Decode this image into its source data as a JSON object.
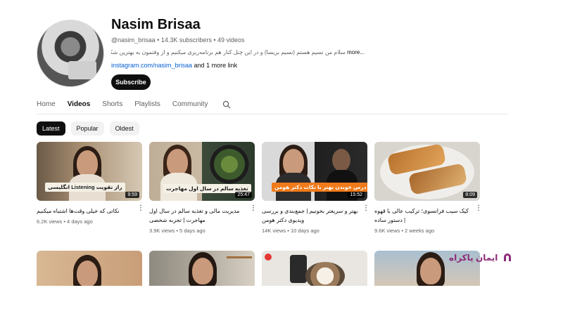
{
  "channel": {
    "name": "Nasim Brisaa",
    "meta": "@nasim_brisaa • 14.3K subscribers • 49 videos",
    "description": "سلام من نسیم هستم (نسیم بریسا) و در این چنل کنار هم برنامه‌ریزی میکنیم و از وقتمون به بهترین شکل استفاده میکنیم. باهم کتاب",
    "more_label": "...more",
    "link_text": "instagram.com/nasim_brisaa",
    "link_suffix": " and 1 more link",
    "subscribe_label": "Subscribe"
  },
  "tabs": [
    "Home",
    "Videos",
    "Shorts",
    "Playlists",
    "Community"
  ],
  "chips": [
    "Latest",
    "Popular",
    "Oldest"
  ],
  "videos": [
    {
      "overlay": "راز تقویت Listening انگلیسی",
      "duration": "9:59",
      "title": "نکاتی که خیلی وقت‌ها اشتباه میکنیم",
      "meta": "6.2K views • 4 days ago"
    },
    {
      "overlay": "تغذیه سالم در سال اول مهاجرت",
      "duration": "25:47",
      "title": "مدیریت مالی و تغذیه سالم در سال اول مهاجرت | تجربه شخصی",
      "meta": "3.9K views • 5 days ago"
    },
    {
      "overlay": "درس خوندن بهتر با نکات دکتر هومن",
      "duration": "15:52",
      "title": "بهتر و سریعتر بخونیم | جمع‌بندی و بررسی ویدیوی دکتر هومن",
      "meta": "14K views • 10 days ago"
    },
    {
      "overlay": "",
      "duration": "8:09",
      "title": "کیک سیب فرانسوی؛ ترکیب عالی با قهوه | دستور ساده",
      "meta": "9.6K views • 2 weeks ago"
    }
  ],
  "watermark": {
    "text": "ایمان پاکراه"
  },
  "colors": {
    "accent_link": "#065fd4",
    "watermark": "#8e2a78",
    "overlay_orange": "#f07a1a"
  }
}
